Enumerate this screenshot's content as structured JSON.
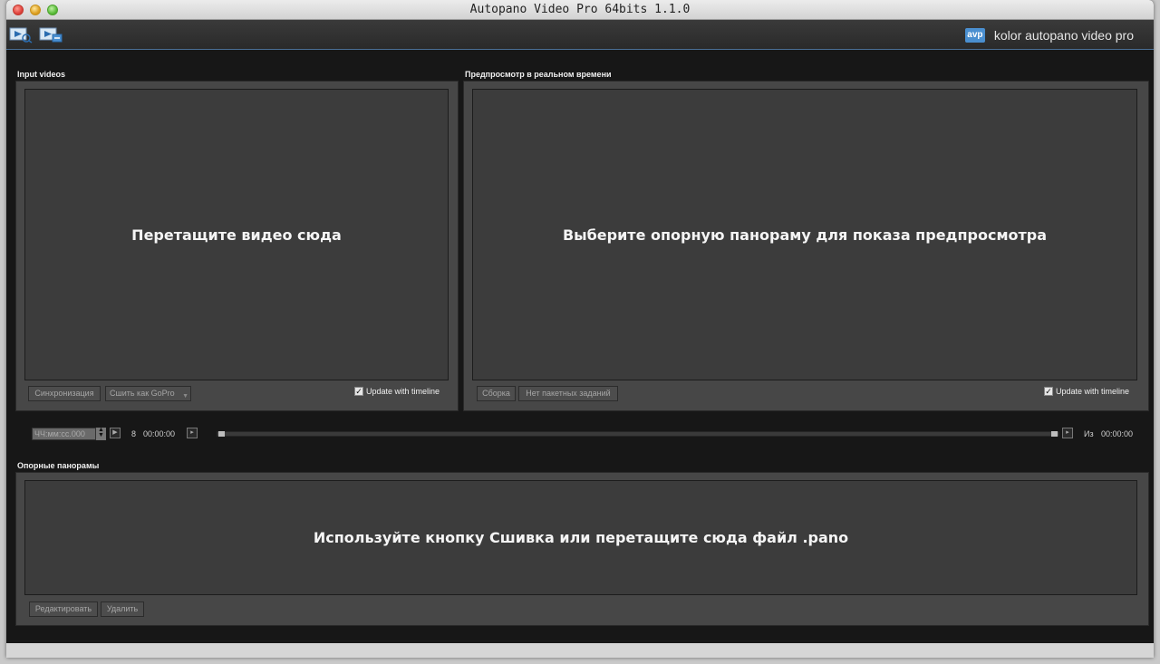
{
  "window": {
    "title": "Autopano Video Pro 64bits 1.1.0"
  },
  "toolbar": {
    "import_icon": "video-import-icon",
    "export_icon": "video-export-icon",
    "brand_logo": "avp",
    "brand_text": "kolor autopano video pro"
  },
  "input_panel": {
    "label": "Input videos",
    "drop_text": "Перетащите видео сюда",
    "sync_button": "Синхронизация",
    "stitch_button": "Сшить как GoPro",
    "update_label": "Update with timeline",
    "update_checked": true
  },
  "preview_panel": {
    "label": "Предпросмотр в реальном времени",
    "drop_text": "Выберите опорную панораму для показа предпросмотра",
    "build_button": "Сборка",
    "batch_button": "Нет пакетных заданий",
    "update_label": "Update with timeline",
    "update_checked": true
  },
  "timeline": {
    "time_placeholder": "ЧЧ:мм:сс.000",
    "frame": "8",
    "current_time": "00:00:00",
    "out_label": "Из",
    "end_time": "00:00:00"
  },
  "ref_panel": {
    "label": "Опорные панорамы",
    "drop_text": "Используйте кнопку Сшивка или перетащите сюда файл .pano",
    "edit_button": "Редактировать",
    "delete_button": "Удалить"
  }
}
